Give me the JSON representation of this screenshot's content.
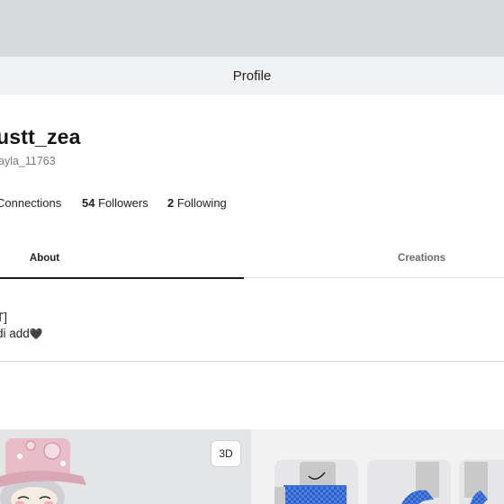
{
  "header": {
    "title": "Profile"
  },
  "profile": {
    "display_name": "ustt_zea",
    "username": "ayla_11763"
  },
  "stats": {
    "connections_label": "Connections",
    "followers_count": "54",
    "followers_label": "Followers",
    "following_count": "2",
    "following_label": "Following"
  },
  "tabs": [
    {
      "label": "About",
      "active": true
    },
    {
      "label": "Creations",
      "active": false
    }
  ],
  "about": {
    "line1": "T]",
    "line2": "di add"
  },
  "avatar": {
    "view_3d_label": "3D"
  },
  "colors": {
    "top_band": "#d9dadc",
    "title_bar": "#f0f1f2",
    "tab_indicator": "#1b1b1b",
    "avatar_panel_bg": "#e4e5e7"
  }
}
